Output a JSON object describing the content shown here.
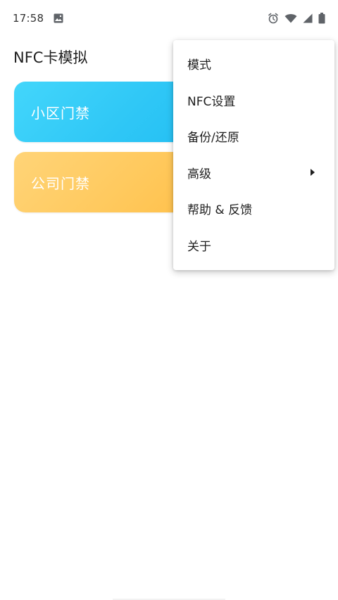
{
  "status_bar": {
    "time": "17:58",
    "icons": [
      "image-icon",
      "alarm-icon",
      "wifi-icon",
      "cell-signal-icon",
      "battery-icon"
    ]
  },
  "app": {
    "title": "NFC卡模拟"
  },
  "cards": [
    {
      "label": "小区门禁",
      "color": "#2fc7f6"
    },
    {
      "label": "公司门禁",
      "color": "#ffc95d"
    }
  ],
  "menu": {
    "items": [
      {
        "label": "模式"
      },
      {
        "label": "NFC设置"
      },
      {
        "label": "备份/还原"
      },
      {
        "label": "高级",
        "has_submenu": true
      },
      {
        "label": "帮助 & 反馈"
      },
      {
        "label": "关于"
      }
    ]
  }
}
